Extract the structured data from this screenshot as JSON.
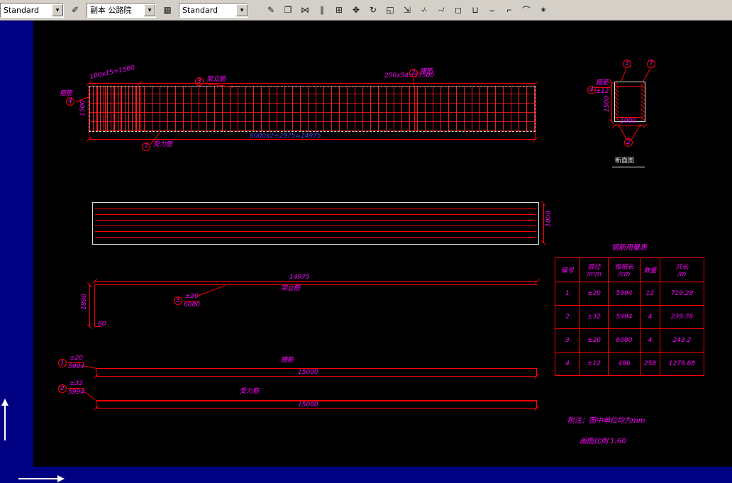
{
  "colors": {
    "line_red": "#ff0000",
    "annotation_magenta": "#ff00ff",
    "dim_blue": "#4747ff",
    "paper_black": "#000000",
    "workspace_navy": "#000082",
    "chrome_gray": "#d4d0c8"
  },
  "toolbar": {
    "text_style_combo": "Standard",
    "layer_combo": "副本 公路院",
    "dim_style_combo": "Standard",
    "combo_arrow_glyph": "▼",
    "style_button_glyph": "✐",
    "layer_button_glyph": "▦",
    "icons": [
      {
        "name": "match-properties",
        "glyph": "✎"
      },
      {
        "name": "copy",
        "glyph": "❐"
      },
      {
        "name": "mirror",
        "glyph": "⋈"
      },
      {
        "name": "offset",
        "glyph": "∥"
      },
      {
        "name": "array",
        "glyph": "⊞"
      },
      {
        "name": "move",
        "glyph": "✥"
      },
      {
        "name": "rotate",
        "glyph": "↻"
      },
      {
        "name": "scale",
        "glyph": "◱"
      },
      {
        "name": "stretch",
        "glyph": "⇲"
      },
      {
        "name": "trim",
        "glyph": "-/-"
      },
      {
        "name": "extend",
        "glyph": "--/"
      },
      {
        "name": "break-at-point",
        "glyph": "◻"
      },
      {
        "name": "break",
        "glyph": "⊔"
      },
      {
        "name": "join",
        "glyph": "⌣"
      },
      {
        "name": "chamfer",
        "glyph": "⌐"
      },
      {
        "name": "fillet",
        "glyph": "⌒"
      },
      {
        "name": "explode",
        "glyph": "✶"
      }
    ]
  },
  "elevation": {
    "dim_top_left": "100x15=1500",
    "dim_top_right": "250x54=13500",
    "dim_bottom": "6000x2+2975=14975",
    "dim_height": "1500",
    "stirrup_num": "4",
    "stirrup_label": "箍筋",
    "erection_num": "3",
    "erection_label": "架立筋",
    "waist_num": "2",
    "waist_label": "腰筋",
    "main_num": "7",
    "main_label": "受力筋"
  },
  "section": {
    "top_left_num": "3",
    "top_right_num": "7",
    "bottom_num": "2",
    "stirrup_num": "4",
    "stirrup_label": "箍筋",
    "stirrup_dia": "±12",
    "dim_width": "1000",
    "dim_height": "1500",
    "caption": "断面图"
  },
  "plan": {
    "dim_right": "1000"
  },
  "erection_bar": {
    "dim_length": "14975",
    "label": "架立筋",
    "num": "3",
    "dia": "±20",
    "unit_len": "6080",
    "dim_height": "1890",
    "dim_hook": "60"
  },
  "waist_bar": {
    "num": "1",
    "dia": "±20",
    "unit_len": "5994",
    "label": "腰筋",
    "dim_length": "15000"
  },
  "main_bar": {
    "num": "2",
    "dia": "±32",
    "unit_len": "5994",
    "label": "受力筋",
    "dim_length": "15000"
  },
  "table": {
    "title": "钢筋用量表",
    "headers": [
      [
        "编号",
        ""
      ],
      [
        "直径",
        "/mm"
      ],
      [
        "每根长",
        "/cm"
      ],
      [
        "数量",
        ""
      ],
      [
        "共长",
        "/m"
      ]
    ],
    "rows": [
      [
        "1",
        "±20",
        "5994",
        "12",
        "719.28"
      ],
      [
        "2",
        "±32",
        "5994",
        "4",
        "239.76"
      ],
      [
        "3",
        "±20",
        "6080",
        "4",
        "243.2"
      ],
      [
        "4",
        "±12",
        "496",
        "258",
        "1279.68"
      ]
    ]
  },
  "notes": {
    "unit_note": "附注：图中单位均为mm",
    "scale_note": "画图比例 1:60"
  }
}
